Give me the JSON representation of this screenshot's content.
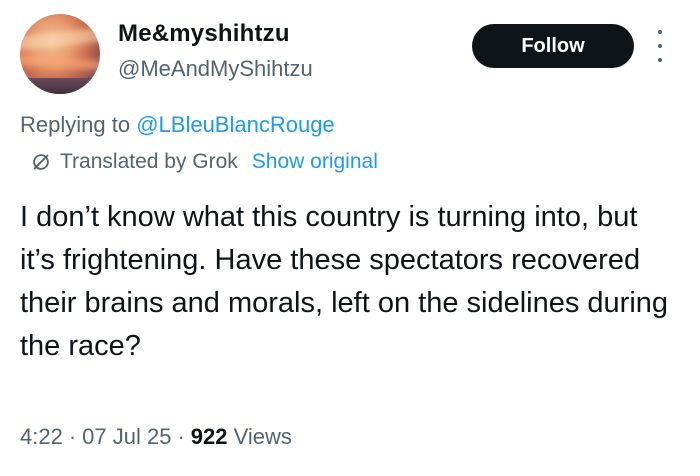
{
  "user": {
    "display_name": "Me&myshihtzu",
    "handle": "@MeAndMyShihtzu"
  },
  "follow_label": "Follow",
  "more_icon": "more-vertical-icon",
  "reply": {
    "prefix": "Replying to",
    "mention": "@LBleuBlancRouge"
  },
  "translation": {
    "icon": "translate-icon",
    "label": "Translated by Grok",
    "show_original": "Show original"
  },
  "tweet": {
    "text": "I don’t know what this country is turning into, but it’s frightening. Have these spectators recovered their brains and morals, left on the sidelines during the race?"
  },
  "meta": {
    "time": "4:22",
    "date": "07 Jul 25",
    "views_count": "922",
    "views_label": "Views"
  },
  "colors": {
    "text": "#0f1419",
    "secondary": "#536471",
    "link": "#1d9bf0",
    "button_bg": "#0f1419",
    "button_text": "#ffffff"
  }
}
